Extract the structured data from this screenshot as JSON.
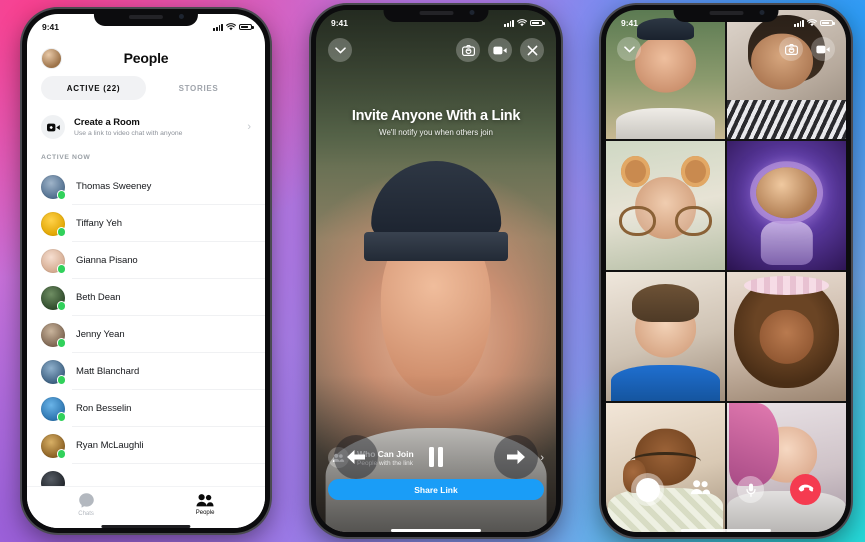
{
  "background": {
    "colors": [
      "#f8408f",
      "#2b9bf4",
      "#25d8d8",
      "#9a5fd8",
      "#b07ae8"
    ]
  },
  "left_phone": {
    "status": {
      "time": "9:41",
      "signal_icon": "signal-bars-icon",
      "wifi_icon": "wifi-icon",
      "battery_icon": "battery-icon"
    },
    "header": {
      "title": "People",
      "avatar_icon": "profile-avatar"
    },
    "tabs": [
      {
        "label": "ACTIVE (22)",
        "selected": true
      },
      {
        "label": "STORIES",
        "selected": false
      }
    ],
    "create_room": {
      "title": "Create a Room",
      "subtitle": "Use a link to video chat with anyone",
      "icon": "video-room-icon",
      "chevron": "chevron-right-icon"
    },
    "section_label": "ACTIVE NOW",
    "contacts": [
      {
        "name": "Thomas Sweeney",
        "status": "online"
      },
      {
        "name": "Tiffany Yeh",
        "status": "online"
      },
      {
        "name": "Gianna Pisano",
        "status": "online"
      },
      {
        "name": "Beth Dean",
        "status": "online"
      },
      {
        "name": "Jenny Yean",
        "status": "online"
      },
      {
        "name": "Matt Blanchard",
        "status": "online"
      },
      {
        "name": "Ron Besselin",
        "status": "online"
      },
      {
        "name": "Ryan McLaughli",
        "status": "online"
      }
    ],
    "tabbar": [
      {
        "label": "Chats",
        "icon": "chat-bubble-icon",
        "active": false
      },
      {
        "label": "People",
        "icon": "people-icon",
        "active": true
      }
    ]
  },
  "center_phone": {
    "status": {
      "time": "9:41"
    },
    "top_controls": [
      {
        "icon": "chevron-down-icon",
        "name": "minimize-button"
      },
      {
        "icon": "camera-flip-icon",
        "name": "switch-camera-button"
      },
      {
        "icon": "video-camera-icon",
        "name": "toggle-video-button"
      },
      {
        "icon": "close-x-icon",
        "name": "close-button"
      }
    ],
    "headline": "Invite Anyone With a Link",
    "subtext": "We'll notify you when others join",
    "who_can_join": {
      "title": "Who Can Join",
      "subtitle": "People with the link",
      "icon": "people-group-icon",
      "chevron": "chevron-right-icon"
    },
    "share_button": "Share Link",
    "player_controls": [
      {
        "icon": "previous-arrow-icon",
        "name": "previous-button"
      },
      {
        "icon": "pause-icon",
        "name": "pause-button"
      },
      {
        "icon": "next-arrow-icon",
        "name": "next-button"
      }
    ]
  },
  "right_phone": {
    "status": {
      "time": "9:41"
    },
    "top_controls": [
      {
        "icon": "chevron-down-icon",
        "name": "minimize-button"
      },
      {
        "icon": "camera-flip-icon",
        "name": "switch-camera-button"
      },
      {
        "icon": "video-camera-icon",
        "name": "toggle-video-button"
      }
    ],
    "participant_count": 8,
    "bottom_controls": [
      {
        "icon": "shutter-circle-icon",
        "name": "effects-button"
      },
      {
        "icon": "people-icon",
        "name": "add-people-button"
      },
      {
        "icon": "microphone-icon",
        "name": "mute-button"
      },
      {
        "icon": "end-call-icon",
        "name": "end-call-button"
      }
    ]
  }
}
